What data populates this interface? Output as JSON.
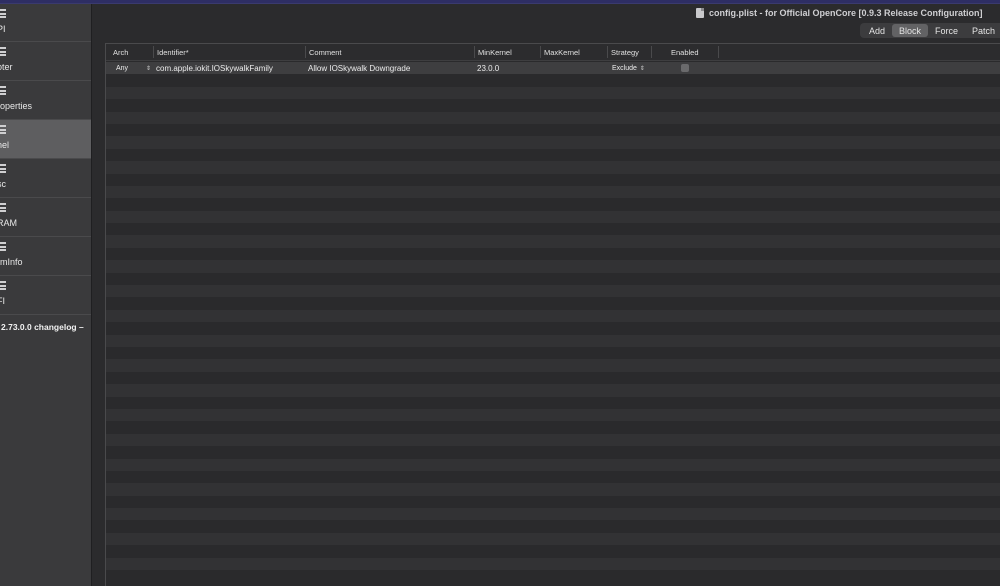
{
  "window": {
    "title": "config.plist - for Official OpenCore [0.9.3 Release Configuration]"
  },
  "sidebar": {
    "items": [
      {
        "label": "PI"
      },
      {
        "label": "oter"
      },
      {
        "label": "roperties"
      },
      {
        "label": "nel"
      },
      {
        "label": "sc"
      },
      {
        "label": "RAM"
      },
      {
        "label": "rmInfo"
      },
      {
        "label": "FI"
      }
    ],
    "selected_index": 3,
    "changelog": "2.73.0.0 changelog –"
  },
  "tabs": [
    "Add",
    "Block",
    "Force",
    "Patch"
  ],
  "active_tab": "Block",
  "table": {
    "columns": [
      "Arch",
      "Identifier*",
      "Comment",
      "MinKernel",
      "MaxKernel",
      "Strategy",
      "Enabled"
    ],
    "rows": [
      {
        "arch": "Any",
        "identifier": "com.apple.iokit.IOSkywalkFamily",
        "comment": "Allow IOSkywalk Downgrade",
        "min_kernel": "23.0.0",
        "max_kernel": "",
        "strategy": "Exclude",
        "enabled": false
      }
    ]
  }
}
